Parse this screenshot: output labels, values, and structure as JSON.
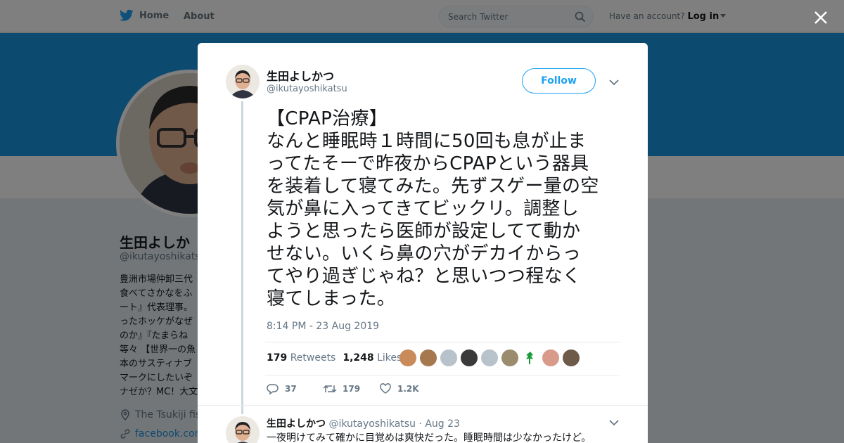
{
  "nav": {
    "home_label": "Home",
    "about_label": "About",
    "search_placeholder": "Search Twitter",
    "account_prompt": "Have an account?",
    "login_label": "Log in"
  },
  "profile": {
    "name": "生田よしか",
    "handle": "@ikutayoshikatsu",
    "bio": "豊洲市場仲卸三代\n食べてさかなをふ\nート』代表理事。\nったホッケがなぜ\nのか』『たまらね\n等々 【世界一の魚\n本のサスティナブ\nマークにしたいぞ\nナゼか？MC！大文",
    "location": "The Tsukiji fish",
    "link": "facebook.com/"
  },
  "tweet": {
    "author_name": "生田よしかつ",
    "author_handle": "@ikutayoshikatsu",
    "follow_label": "Follow",
    "text": "【CPAP治療】\nなんと睡眠時１時間に50回も息が止ま\nってたそーで昨夜からCPAPという器具\nを装着して寝てみた。先ずスゲー量の空\n気が鼻に入ってきてビックリ。調整し\nようと思ったら医師が設定してて動か\nせない。いくら鼻の穴がデカイからっ\nてやり過ぎじゃね？と思いつつ程なく\n寝てしまった。",
    "timestamp": "8:14 PM - 23 Aug 2019",
    "retweets_count": "179",
    "retweets_label": "Retweets",
    "likes_count": "1,248",
    "likes_label": "Likes",
    "reply_count": "37",
    "retweet_action_count": "179",
    "like_action_count": "1.2K"
  },
  "reply": {
    "author_name": "生田よしかつ",
    "author_handle": "@ikutayoshikatsu",
    "date": "· Aug 23",
    "text": "一夜明けてみて確かに目覚めは爽快だった。睡眠時間は少なかったけど。"
  },
  "colors": {
    "brand": "#1da1f2",
    "banner": "#1b95e0"
  }
}
